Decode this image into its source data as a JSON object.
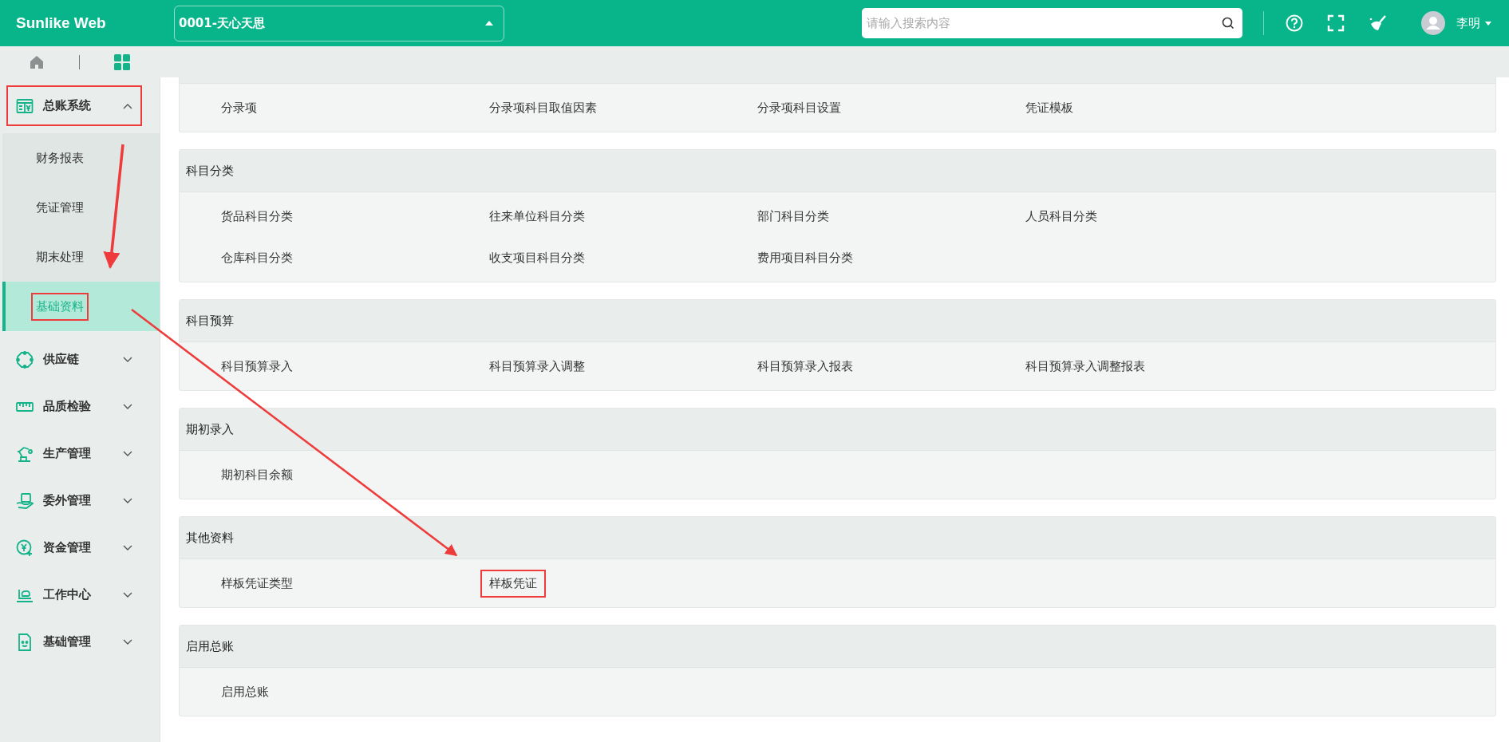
{
  "app": {
    "title": "Sunlike Web"
  },
  "company_selector": {
    "value": "0001-天心天思"
  },
  "search": {
    "placeholder": "请输入搜索内容"
  },
  "user": {
    "name": "李明"
  },
  "sidebar": {
    "items": [
      {
        "label": "总账系统",
        "expanded": true,
        "highlighted": true,
        "children": [
          {
            "label": "财务报表",
            "selected": false,
            "highlighted": false
          },
          {
            "label": "凭证管理",
            "selected": false,
            "highlighted": false
          },
          {
            "label": "期末处理",
            "selected": false,
            "highlighted": false
          },
          {
            "label": "基础资料",
            "selected": true,
            "highlighted": true
          }
        ]
      },
      {
        "label": "供应链",
        "expanded": false,
        "highlighted": false
      },
      {
        "label": "品质检验",
        "expanded": false,
        "highlighted": false
      },
      {
        "label": "生产管理",
        "expanded": false,
        "highlighted": false
      },
      {
        "label": "委外管理",
        "expanded": false,
        "highlighted": false
      },
      {
        "label": "资金管理",
        "expanded": false,
        "highlighted": false
      },
      {
        "label": "工作中心",
        "expanded": false,
        "highlighted": false
      },
      {
        "label": "基础管理",
        "expanded": false,
        "highlighted": false
      }
    ]
  },
  "sections": [
    {
      "items": [
        {
          "label": "分录项",
          "highlighted": false
        },
        {
          "label": "分录项科目取值因素",
          "highlighted": false
        },
        {
          "label": "分录项科目设置",
          "highlighted": false
        },
        {
          "label": "凭证模板",
          "highlighted": false
        }
      ]
    },
    {
      "title": "科目分类",
      "items": [
        {
          "label": "货品科目分类",
          "highlighted": false
        },
        {
          "label": "往来单位科目分类",
          "highlighted": false
        },
        {
          "label": "部门科目分类",
          "highlighted": false
        },
        {
          "label": "人员科目分类",
          "highlighted": false
        },
        {
          "label": "仓库科目分类",
          "highlighted": false
        },
        {
          "label": "收支项目科目分类",
          "highlighted": false
        },
        {
          "label": "费用项目科目分类",
          "highlighted": false
        }
      ]
    },
    {
      "title": "科目预算",
      "items": [
        {
          "label": "科目预算录入",
          "highlighted": false
        },
        {
          "label": "科目预算录入调整",
          "highlighted": false
        },
        {
          "label": "科目预算录入报表",
          "highlighted": false
        },
        {
          "label": "科目预算录入调整报表",
          "highlighted": false
        }
      ]
    },
    {
      "title": "期初录入",
      "items": [
        {
          "label": "期初科目余额",
          "highlighted": false
        }
      ]
    },
    {
      "title": "其他资料",
      "items": [
        {
          "label": "样板凭证类型",
          "highlighted": false
        },
        {
          "label": "样板凭证",
          "highlighted": true
        }
      ]
    },
    {
      "title": "启用总账",
      "items": [
        {
          "label": "启用总账",
          "highlighted": false
        }
      ]
    }
  ]
}
